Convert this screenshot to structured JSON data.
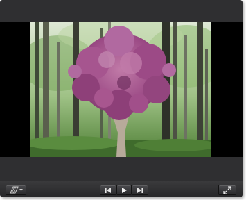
{
  "player": {
    "icons": {
      "view_mode": "parallelogram-view-icon",
      "view_menu": "chevron-down-icon",
      "previous": "skip-previous-icon",
      "play": "play-icon",
      "next": "skip-next-icon",
      "fullscreen": "expand-fullscreen-icon"
    },
    "colors": {
      "frame": "#2b2b2d",
      "letterbox": "#000000",
      "foliage": "#a24f8a",
      "forest": "#4f8a3e"
    }
  }
}
